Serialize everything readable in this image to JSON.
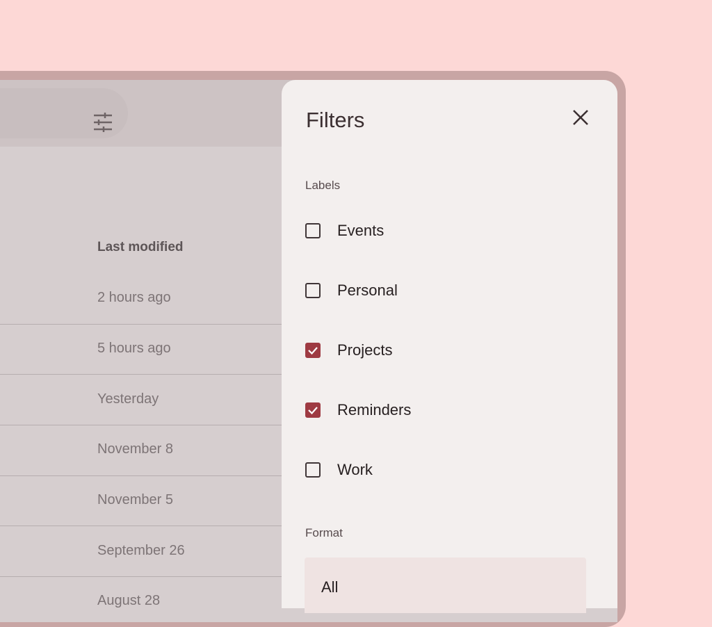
{
  "list": {
    "column_header": "Last modified",
    "rows": [
      "2 hours ago",
      "5 hours ago",
      "Yesterday",
      "November 8",
      "November 5",
      "September 26",
      "August 28"
    ]
  },
  "filters": {
    "title": "Filters",
    "close_icon": "close-icon",
    "labels_heading": "Labels",
    "labels": [
      {
        "text": "Events",
        "checked": false
      },
      {
        "text": "Personal",
        "checked": false
      },
      {
        "text": "Projects",
        "checked": true
      },
      {
        "text": "Reminders",
        "checked": true
      },
      {
        "text": "Work",
        "checked": false
      }
    ],
    "format_heading": "Format",
    "format_selected": "All"
  },
  "toolbar": {
    "filter_icon": "tune-icon"
  },
  "colors": {
    "background": "#fdd8d6",
    "accent": "#9e3a42",
    "panel": "#f3efee",
    "scrim": "#d6cecf"
  }
}
